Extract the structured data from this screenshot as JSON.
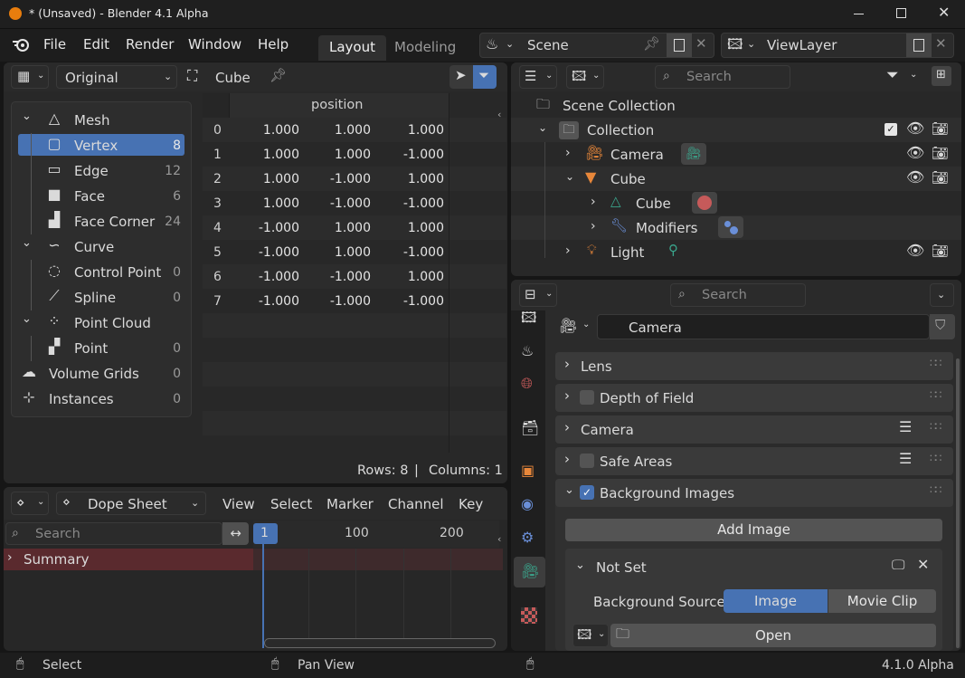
{
  "window": {
    "title": "* (Unsaved) - Blender 4.1 Alpha"
  },
  "menu": {
    "items": [
      "File",
      "Edit",
      "Render",
      "Window",
      "Help"
    ]
  },
  "workspaces": {
    "active": "Layout",
    "other": "Modeling"
  },
  "scene": {
    "name": "Scene"
  },
  "view_layer": {
    "name": "ViewLayer"
  },
  "spreadsheet": {
    "eval_mode": "Original",
    "object_name": "Cube",
    "column_header": "position",
    "rows": [
      {
        "i": "0",
        "x": "1.000",
        "y": "1.000",
        "z": "1.000"
      },
      {
        "i": "1",
        "x": "1.000",
        "y": "1.000",
        "z": "-1.000"
      },
      {
        "i": "2",
        "x": "1.000",
        "y": "-1.000",
        "z": "1.000"
      },
      {
        "i": "3",
        "x": "1.000",
        "y": "-1.000",
        "z": "-1.000"
      },
      {
        "i": "4",
        "x": "-1.000",
        "y": "1.000",
        "z": "1.000"
      },
      {
        "i": "5",
        "x": "-1.000",
        "y": "1.000",
        "z": "-1.000"
      },
      {
        "i": "6",
        "x": "-1.000",
        "y": "-1.000",
        "z": "1.000"
      },
      {
        "i": "7",
        "x": "-1.000",
        "y": "-1.000",
        "z": "-1.000"
      }
    ],
    "rows_label": "Rows: 8",
    "sep": "|",
    "columns_label": "Columns: 1",
    "domains": [
      {
        "label": "Mesh",
        "count": "",
        "type": "group"
      },
      {
        "label": "Vertex",
        "count": "8",
        "type": "child",
        "selected": true
      },
      {
        "label": "Edge",
        "count": "12",
        "type": "child"
      },
      {
        "label": "Face",
        "count": "6",
        "type": "child"
      },
      {
        "label": "Face Corner",
        "count": "24",
        "type": "child"
      },
      {
        "label": "Curve",
        "count": "",
        "type": "group"
      },
      {
        "label": "Control Point",
        "count": "0",
        "type": "child"
      },
      {
        "label": "Spline",
        "count": "0",
        "type": "child"
      },
      {
        "label": "Point Cloud",
        "count": "",
        "type": "group"
      },
      {
        "label": "Point",
        "count": "0",
        "type": "child"
      },
      {
        "label": "Volume Grids",
        "count": "0",
        "type": "root"
      },
      {
        "label": "Instances",
        "count": "0",
        "type": "root"
      }
    ]
  },
  "outliner": {
    "search_placeholder": "Search",
    "scene_collection": "Scene Collection",
    "collection": "Collection",
    "camera": "Camera",
    "cube": "Cube",
    "cube_mesh": "Cube",
    "modifiers": "Modifiers",
    "light": "Light"
  },
  "dopesheet": {
    "mode": "Dope Sheet",
    "menus": [
      "View",
      "Select",
      "Marker",
      "Channel",
      "Key"
    ],
    "search_placeholder": "Search",
    "current_frame": "1",
    "ticks": [
      "100",
      "200"
    ],
    "summary": "Summary"
  },
  "properties": {
    "search_placeholder": "Search",
    "data_name": "Camera",
    "panels": {
      "lens": "Lens",
      "dof": "Depth of Field",
      "camera": "Camera",
      "safe_areas": "Safe Areas",
      "bg_images": "Background Images"
    },
    "add_image": "Add Image",
    "not_set": "Not Set",
    "bg_source_label": "Background Source",
    "bg_source_image": "Image",
    "bg_source_movie": "Movie Clip",
    "open": "Open"
  },
  "status": {
    "select": "Select",
    "pan": "Pan View",
    "version": "4.1.0 Alpha"
  },
  "colors": {
    "accent": "#4772b3",
    "camera_green": "#3aa58c",
    "object_orange": "#e8873a",
    "summary_red": "#5a2a2e"
  }
}
